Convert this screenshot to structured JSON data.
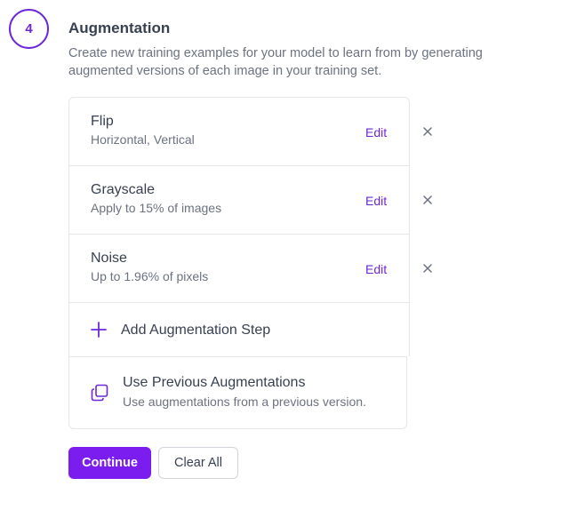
{
  "step": {
    "number": "4",
    "title": "Augmentation",
    "description": "Create new training examples for your model to learn from by generating augmented versions of each image in your training set."
  },
  "augmentations": [
    {
      "name": "Flip",
      "detail": "Horizontal, Vertical",
      "edit_label": "Edit",
      "remove_icon": "close-icon"
    },
    {
      "name": "Grayscale",
      "detail": "Apply to 15% of images",
      "edit_label": "Edit",
      "remove_icon": "close-icon"
    },
    {
      "name": "Noise",
      "detail": "Up to 1.96% of pixels",
      "edit_label": "Edit",
      "remove_icon": "close-icon"
    }
  ],
  "add_step": {
    "label": "Add Augmentation Step",
    "icon": "plus-icon"
  },
  "previous": {
    "title": "Use Previous Augmentations",
    "subtitle": "Use augmentations from a previous version.",
    "icon": "copy-icon"
  },
  "actions": {
    "continue_label": "Continue",
    "clear_label": "Clear All"
  },
  "colors": {
    "accent": "#7c1df0",
    "accent_text": "#6d28d9",
    "border": "#e5e7eb",
    "muted": "#6b7280"
  }
}
